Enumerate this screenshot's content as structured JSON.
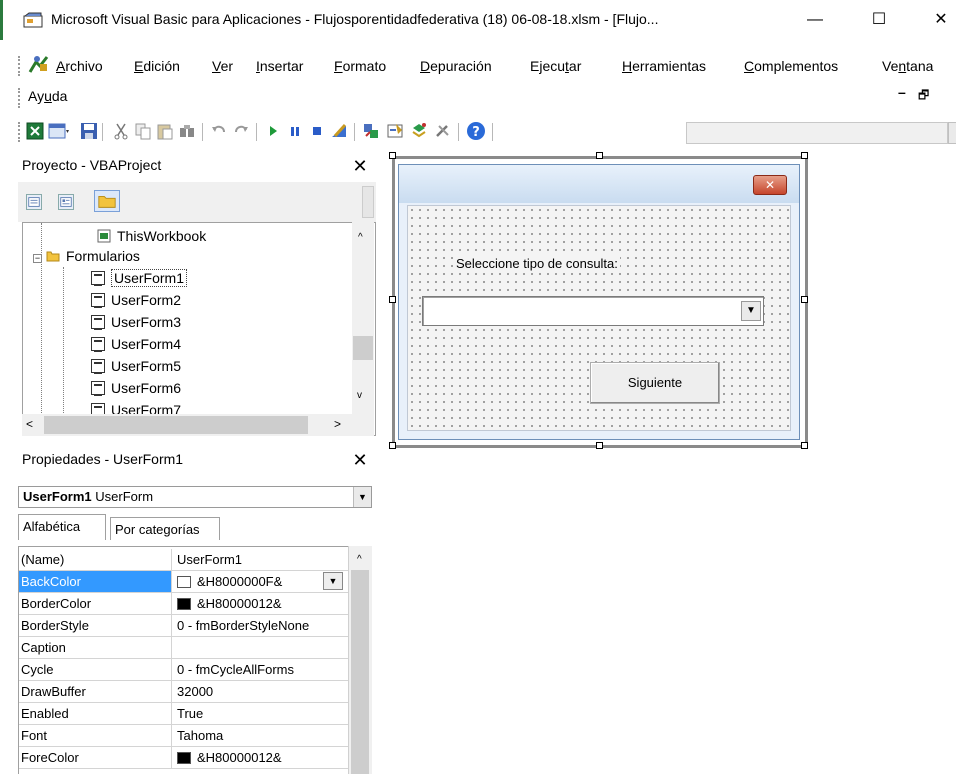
{
  "window": {
    "title": "Microsoft Visual Basic para Aplicaciones - Flujosporentidadfederativa (18) 06-08-18.xlsm - [Flujo...",
    "minimize": "—",
    "maximize": "☐",
    "close": "✕"
  },
  "menu": {
    "items": [
      {
        "pre": "",
        "key": "A",
        "post": "rchivo"
      },
      {
        "pre": "",
        "key": "E",
        "post": "dición"
      },
      {
        "pre": "",
        "key": "V",
        "post": "er"
      },
      {
        "pre": "",
        "key": "I",
        "post": "nsertar"
      },
      {
        "pre": "",
        "key": "F",
        "post": "ormato"
      },
      {
        "pre": "",
        "key": "D",
        "post": "epuración"
      },
      {
        "pre": "Ejecu",
        "key": "t",
        "post": "ar"
      },
      {
        "pre": "",
        "key": "H",
        "post": "erramientas"
      },
      {
        "pre": "",
        "key": "C",
        "post": "omplementos"
      },
      {
        "pre": "Ve",
        "key": "n",
        "post": "tana"
      }
    ],
    "help": {
      "pre": "Ay",
      "key": "u",
      "post": "da"
    },
    "mdi_min": "–",
    "mdi_restore": "🗗"
  },
  "project": {
    "title": "Proyecto - VBAProject",
    "close": "✕",
    "tree": {
      "workbook": "ThisWorkbook",
      "folder": "Formularios",
      "forms": [
        "UserForm1",
        "UserForm2",
        "UserForm3",
        "UserForm4",
        "UserForm5",
        "UserForm6",
        "UserForm7"
      ]
    }
  },
  "properties": {
    "title": "Propiedades - UserForm1",
    "close": "✕",
    "object_name": "UserForm1",
    "object_type": "UserForm",
    "tabs": [
      "Alfabética",
      "Por categorías"
    ],
    "rows": [
      {
        "name": "(Name)",
        "value": "UserForm1",
        "swatch": null
      },
      {
        "name": "BackColor",
        "value": "&H8000000F&",
        "swatch": "#ffffff"
      },
      {
        "name": "BorderColor",
        "value": "&H80000012&",
        "swatch": "#000000"
      },
      {
        "name": "BorderStyle",
        "value": "0 - fmBorderStyleNone",
        "swatch": null
      },
      {
        "name": "Caption",
        "value": "",
        "swatch": null
      },
      {
        "name": "Cycle",
        "value": "0 - fmCycleAllForms",
        "swatch": null
      },
      {
        "name": "DrawBuffer",
        "value": "32000",
        "swatch": null
      },
      {
        "name": "Enabled",
        "value": "True",
        "swatch": null
      },
      {
        "name": "Font",
        "value": "Tahoma",
        "swatch": null
      },
      {
        "name": "ForeColor",
        "value": "&H80000012&",
        "swatch": "#000000"
      }
    ]
  },
  "form": {
    "label": "Seleccione tipo de consulta:",
    "combo_value": "",
    "button": "Siguiente"
  },
  "colors": {
    "accent": "#3399ff",
    "excel_green": "#2b7a3e"
  }
}
